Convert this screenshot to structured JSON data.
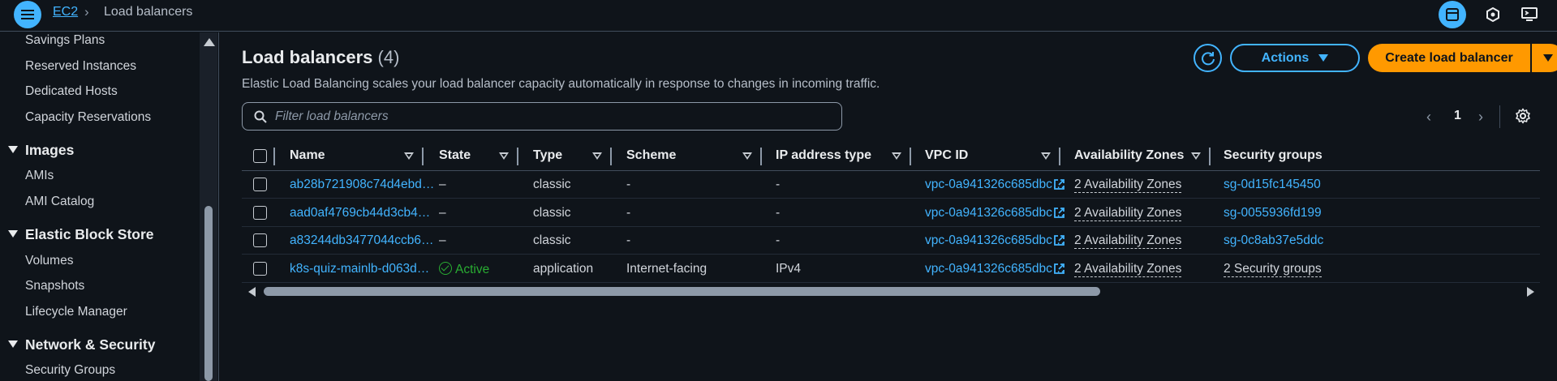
{
  "header": {
    "breadcrumb_root": "EC2",
    "breadcrumb_current": "Load balancers"
  },
  "sidebar": {
    "items": [
      {
        "label": "Savings Plans"
      },
      {
        "label": "Reserved Instances"
      },
      {
        "label": "Dedicated Hosts"
      },
      {
        "label": "Capacity Reservations"
      }
    ],
    "sections": [
      {
        "title": "Images",
        "items": [
          {
            "label": "AMIs"
          },
          {
            "label": "AMI Catalog"
          }
        ]
      },
      {
        "title": "Elastic Block Store",
        "items": [
          {
            "label": "Volumes"
          },
          {
            "label": "Snapshots"
          },
          {
            "label": "Lifecycle Manager"
          }
        ]
      },
      {
        "title": "Network & Security",
        "items": [
          {
            "label": "Security Groups"
          }
        ]
      }
    ]
  },
  "main": {
    "title": "Load balancers",
    "count": "(4)",
    "description": "Elastic Load Balancing scales your load balancer capacity automatically in response to changes in incoming traffic.",
    "actions_label": "Actions",
    "create_label": "Create load balancer",
    "filter_placeholder": "Filter load balancers",
    "page_number": "1"
  },
  "table": {
    "columns": [
      "Name",
      "State",
      "Type",
      "Scheme",
      "IP address type",
      "VPC ID",
      "Availability Zones",
      "Security groups"
    ],
    "rows": [
      {
        "name": "ab28b721908c74d4ebd…",
        "state": "–",
        "type": "classic",
        "scheme": "-",
        "ip": "-",
        "vpc": "vpc-0a941326c685dbc…",
        "az": "2 Availability Zones",
        "sg": "sg-0d15fc145450"
      },
      {
        "name": "aad0af4769cb44d3cb4…",
        "state": "–",
        "type": "classic",
        "scheme": "-",
        "ip": "-",
        "vpc": "vpc-0a941326c685dbc…",
        "az": "2 Availability Zones",
        "sg": "sg-0055936fd199"
      },
      {
        "name": "a83244db3477044ccb6…",
        "state": "–",
        "type": "classic",
        "scheme": "-",
        "ip": "-",
        "vpc": "vpc-0a941326c685dbc…",
        "az": "2 Availability Zones",
        "sg": "sg-0c8ab37e5ddc"
      },
      {
        "name": "k8s-quiz-mainlb-d063d…",
        "state": "Active",
        "type": "application",
        "scheme": "Internet-facing",
        "ip": "IPv4",
        "vpc": "vpc-0a941326c685dbc…",
        "az": "2 Availability Zones",
        "sg": "2 Security groups"
      }
    ]
  },
  "colors": {
    "accent": "#42b4ff",
    "primary_button": "#ff9900",
    "success": "#29ad32",
    "background": "#0f141a"
  }
}
